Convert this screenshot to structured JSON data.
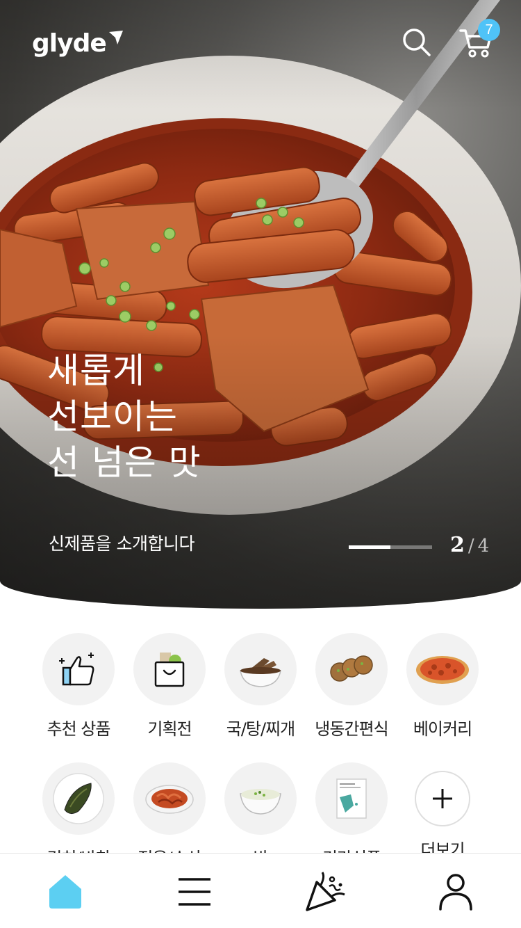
{
  "header": {
    "logo_text": "glyde",
    "cart_count": "7",
    "icons": [
      "search-icon",
      "cart-icon"
    ]
  },
  "hero": {
    "headline": [
      "새롭게",
      "선보이는",
      "선 넘은 맛"
    ],
    "subline": "신제품을 소개합니다",
    "pager": {
      "current": "2",
      "separator": "/",
      "total": "4"
    },
    "progress": 0.5
  },
  "categories": [
    {
      "label": "추천 상품",
      "icon": "thumbs-up-icon"
    },
    {
      "label": "기획전",
      "icon": "shopping-bag-icon"
    },
    {
      "label": "국/탕/찌개",
      "icon": "soup-bowl-icon"
    },
    {
      "label": "냉동간편식",
      "icon": "frozen-patties-icon"
    },
    {
      "label": "베이커리",
      "icon": "pizza-icon"
    },
    {
      "label": "김치/반찬",
      "icon": "kimchi-icon"
    },
    {
      "label": "젓음/수산",
      "icon": "seafood-dish-icon"
    },
    {
      "label": "밥",
      "icon": "rice-bowl-icon"
    },
    {
      "label": "건강식품",
      "icon": "health-food-box-icon"
    },
    {
      "label": "더보기",
      "icon": "plus-icon"
    }
  ],
  "bottom_nav": {
    "items": [
      "home-icon",
      "menu-icon",
      "party-icon",
      "user-icon"
    ],
    "active": "home",
    "accent": "#5ccff2"
  },
  "colors": {
    "badge": "#4fc3f7",
    "category_bg": "#f2f2f2"
  }
}
